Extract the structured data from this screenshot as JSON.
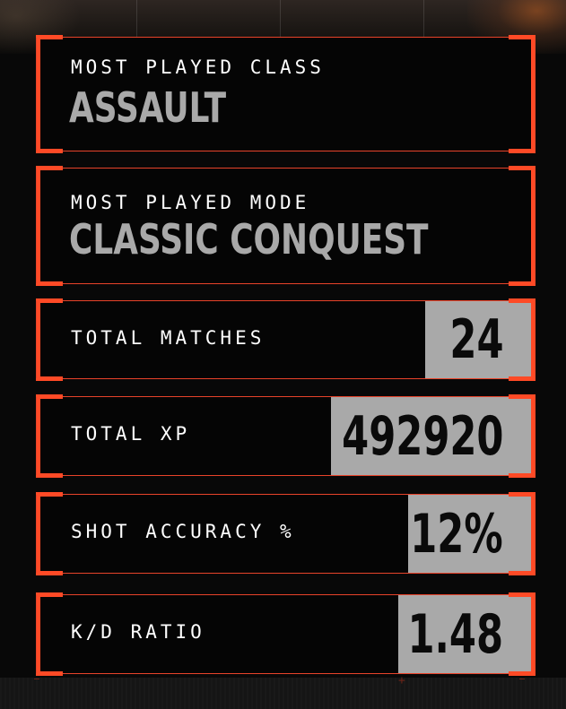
{
  "stats": {
    "most_played_class": {
      "label": "MOST PLAYED CLASS",
      "value": "ASSAULT"
    },
    "most_played_mode": {
      "label": "MOST PLAYED MODE",
      "value": "CLASSIC CONQUEST"
    },
    "total_matches": {
      "label": "TOTAL MATCHES",
      "value": "24"
    },
    "total_xp": {
      "label": "TOTAL XP",
      "value": "492920"
    },
    "shot_accuracy": {
      "label": "SHOT ACCURACY %",
      "value": "12%"
    },
    "kd_ratio": {
      "label": "K/D RATIO",
      "value": "1.48"
    }
  },
  "colors": {
    "accent": "#ff4a26",
    "value_box": "#a9a9a9",
    "panel_bg": "#050505",
    "label_text": "#ffffff"
  }
}
